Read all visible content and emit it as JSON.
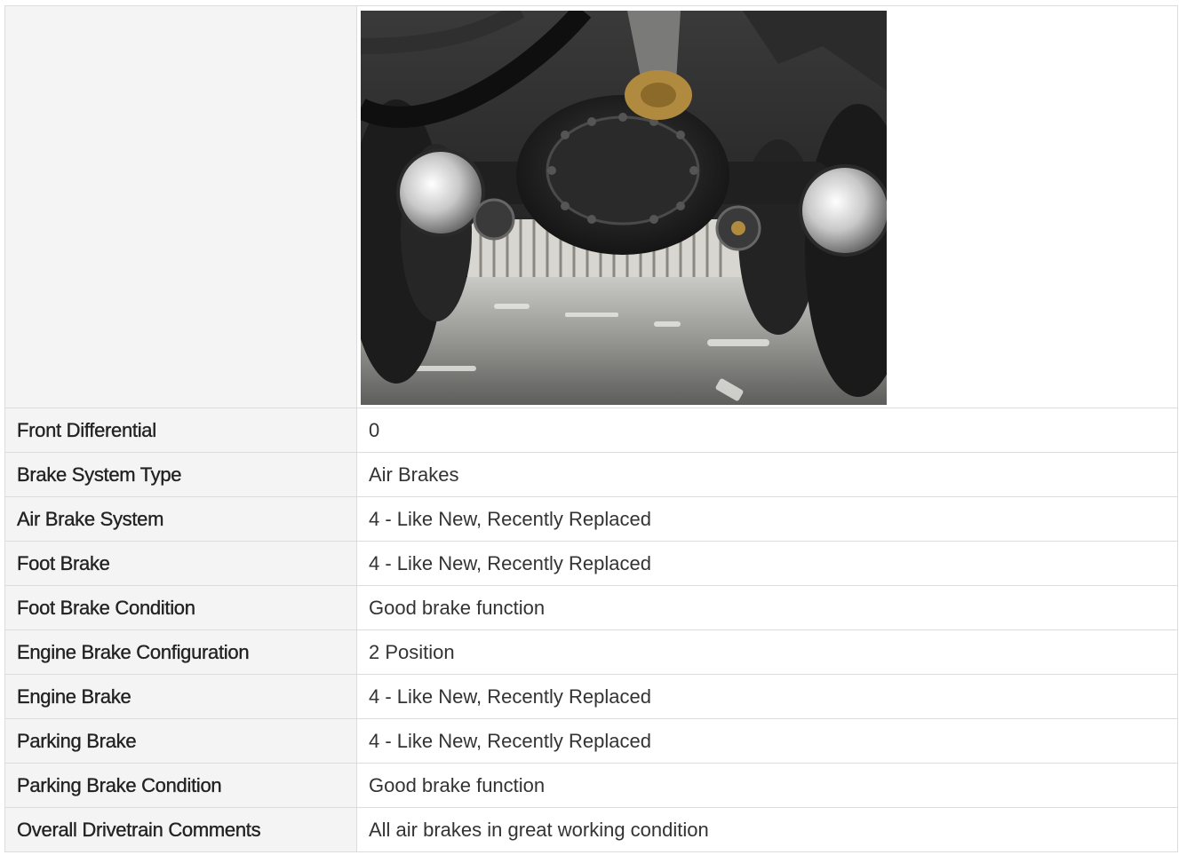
{
  "photo": {
    "subject": "truck-undercarriage-rear-axle-photo"
  },
  "rows": [
    {
      "label": "Front Differential",
      "value": "0"
    },
    {
      "label": "Brake System Type",
      "value": "Air Brakes"
    },
    {
      "label": "Air Brake System",
      "value": "4 - Like New, Recently Replaced"
    },
    {
      "label": "Foot Brake",
      "value": "4 - Like New, Recently Replaced"
    },
    {
      "label": "Foot Brake Condition",
      "value": "Good brake function"
    },
    {
      "label": "Engine Brake Configuration",
      "value": "2 Position"
    },
    {
      "label": "Engine Brake",
      "value": "4 - Like New, Recently Replaced"
    },
    {
      "label": "Parking Brake",
      "value": "4 - Like New, Recently Replaced"
    },
    {
      "label": "Parking Brake Condition",
      "value": "Good brake function"
    },
    {
      "label": "Overall Drivetrain Comments",
      "value": "All air brakes in great working condition"
    }
  ]
}
